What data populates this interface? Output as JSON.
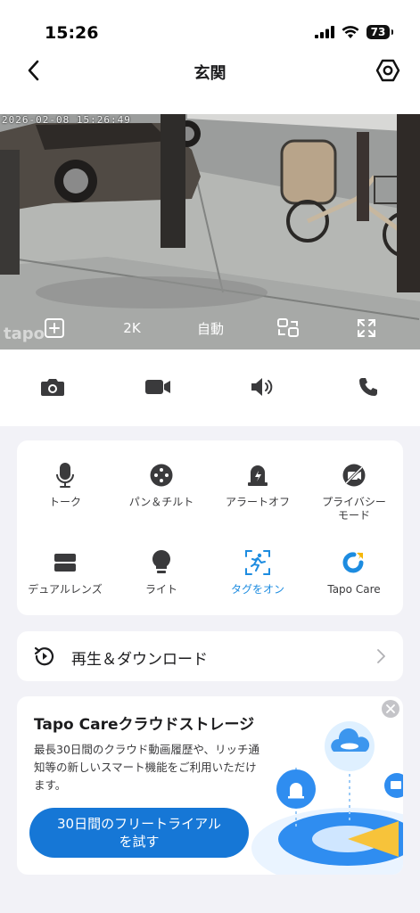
{
  "status": {
    "time": "15:26",
    "battery": "73"
  },
  "nav": {
    "title": "玄関"
  },
  "camera": {
    "timestamp": "2026-02-08 15:26:49",
    "watermark": "tapo",
    "resolution": "2K",
    "mode": "自動"
  },
  "features": [
    {
      "label": "トーク",
      "icon": "microphone-icon"
    },
    {
      "label": "パン＆チルト",
      "icon": "pan-tilt-icon"
    },
    {
      "label": "アラートオフ",
      "icon": "alarm-off-icon"
    },
    {
      "label": "プライバシー\nモード",
      "icon": "privacy-mode-icon"
    },
    {
      "label": "デュアルレンズ",
      "icon": "dual-lens-icon"
    },
    {
      "label": "ライト",
      "icon": "light-bulb-icon"
    },
    {
      "label": "タグをオン",
      "icon": "tag-on-icon",
      "active": true
    },
    {
      "label": "Tapo Care",
      "icon": "tapo-care-icon"
    }
  ],
  "playback": {
    "label": "再生＆ダウンロード"
  },
  "promo": {
    "title": "Tapo Careクラウドストレージ",
    "body": "最長30日間のクラウド動画履歴や、リッチ通知等の新しいスマート機能をご利用いただけます。",
    "button": "30日間のフリートライアル\nを試す"
  },
  "colors": {
    "accent": "#1677d6",
    "active": "#1d8ce0"
  }
}
